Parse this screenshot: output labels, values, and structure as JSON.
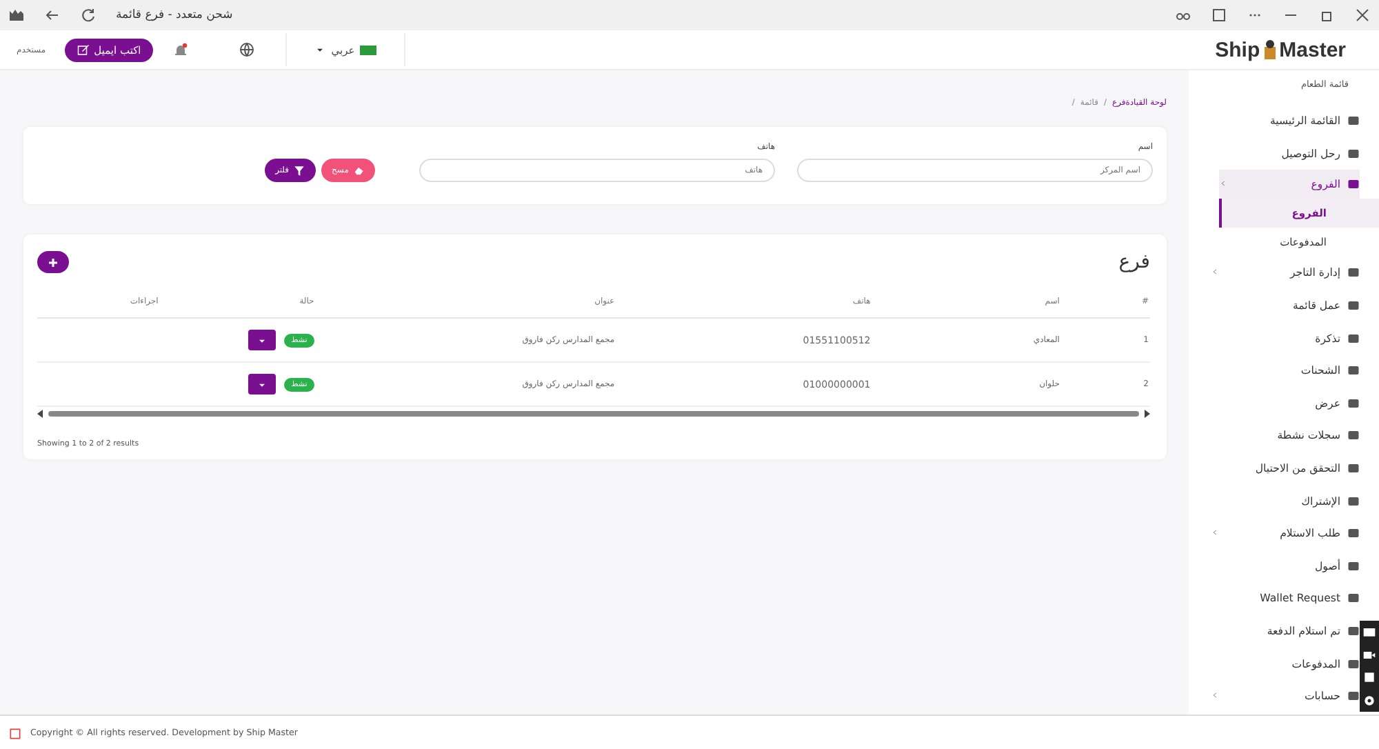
{
  "window": {
    "title": "شحن متعدد - فرع قائمة"
  },
  "header": {
    "logo_left": "Ship",
    "logo_right": "Master",
    "language": "عربي",
    "compose_button": "اكتب ايميل",
    "user": "مستخدم"
  },
  "breadcrumb": [
    "لوحة القيادةفرع",
    "/",
    "قائمة",
    "/"
  ],
  "filters": {
    "fields": [
      {
        "label": "اسم",
        "placeholder": "اسم المركز"
      },
      {
        "label": "هاتف",
        "placeholder": "هاتف"
      }
    ],
    "clear_button": "مسح",
    "filter_button": "فلتر"
  },
  "table": {
    "title": "فرع",
    "columns": [
      "#",
      "اسم",
      "هاتف",
      "عنوان",
      "حالة",
      "اجراءات"
    ],
    "rows": [
      {
        "cells": [
          "1",
          "المعادي",
          "01551100512",
          "مجمع المدارس ركن فاروق"
        ],
        "status": "نشط"
      },
      {
        "cells": [
          "2",
          "حلوان",
          "01000000001",
          "مجمع المدارس ركن فاروق"
        ],
        "status": "نشط"
      }
    ],
    "summary": "Showing 1 to 2 of 2 results"
  },
  "sidebar": {
    "heading": "قائمة الطعام",
    "items": [
      {
        "label": "القائمة الرئيسية",
        "selected": false,
        "has_children": false
      },
      {
        "label": "رحل التوصيل",
        "selected": false,
        "has_children": false
      },
      {
        "label": "الفروع",
        "selected": true,
        "has_children": true,
        "children": [
          {
            "label": "الفروع",
            "selected": true
          },
          {
            "label": "المدفوعات",
            "selected": false
          }
        ]
      },
      {
        "label": "إدارة التاجر",
        "selected": false,
        "has_children": true
      },
      {
        "label": "عمل قائمة",
        "selected": false,
        "has_children": false
      },
      {
        "label": "تذكرة",
        "selected": false,
        "has_children": false
      },
      {
        "label": "الشحنات",
        "selected": false,
        "has_children": false
      },
      {
        "label": "عرض",
        "selected": false,
        "has_children": false
      },
      {
        "label": "سجلات نشطة",
        "selected": false,
        "has_children": false
      },
      {
        "label": "التحقق من الاحتيال",
        "selected": false,
        "has_children": false
      },
      {
        "label": "الإشتراك",
        "selected": false,
        "has_children": false
      },
      {
        "label": "طلب الاستلام",
        "selected": false,
        "has_children": true
      },
      {
        "label": "أصول",
        "selected": false,
        "has_children": false
      },
      {
        "label": "Wallet Request",
        "selected": false,
        "has_children": false
      },
      {
        "label": "تم استلام الدفعة",
        "selected": false,
        "has_children": false
      },
      {
        "label": "المدفوعات",
        "selected": false,
        "has_children": false
      },
      {
        "label": "حسابات",
        "selected": false,
        "has_children": true
      }
    ]
  },
  "footer": {
    "text": "Copyright © All rights reserved. Development by Ship Master"
  }
}
